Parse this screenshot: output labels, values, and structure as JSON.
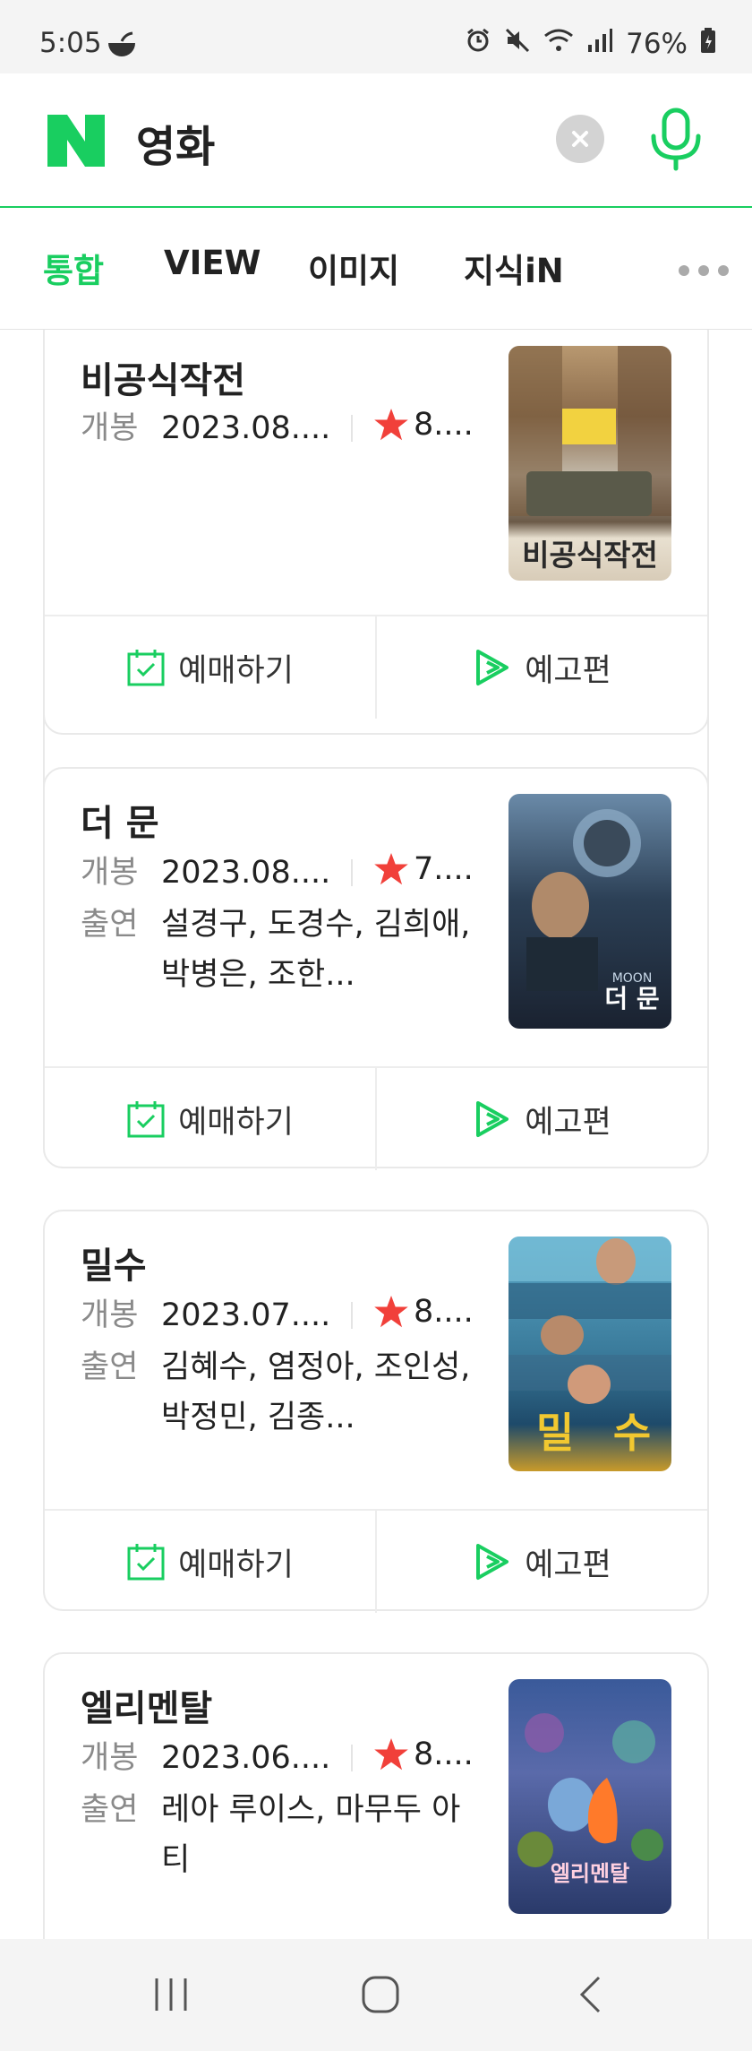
{
  "status_bar": {
    "time": "5:05",
    "battery": "76%"
  },
  "search": {
    "query": "영화",
    "logo_text": "N"
  },
  "tabs": [
    {
      "label": "통합",
      "active": true
    },
    {
      "label": "VIEW",
      "active": false
    },
    {
      "label": "이미지",
      "active": false
    },
    {
      "label": "지식iN",
      "active": false
    }
  ],
  "labels": {
    "release": "개봉",
    "cast": "출연",
    "book": "예매하기",
    "trailer": "예고편"
  },
  "movies": [
    {
      "title": "비공식작전",
      "release": "2023.08....",
      "rating": "8....",
      "cast": ""
    },
    {
      "title": "더 문",
      "release": "2023.08....",
      "rating": "7....",
      "cast": "설경구, 도경수, 김희애, 박병은, 조한..."
    },
    {
      "title": "밀수",
      "release": "2023.07....",
      "rating": "8....",
      "cast": "김혜수, 염정아, 조인성, 박정민, 김종..."
    },
    {
      "title": "엘리멘탈",
      "release": "2023.06....",
      "rating": "8....",
      "cast": "레아 루이스, 마무두 아티"
    }
  ],
  "colors": {
    "brand_green": "#19ce60",
    "star_red": "#f1403a"
  }
}
